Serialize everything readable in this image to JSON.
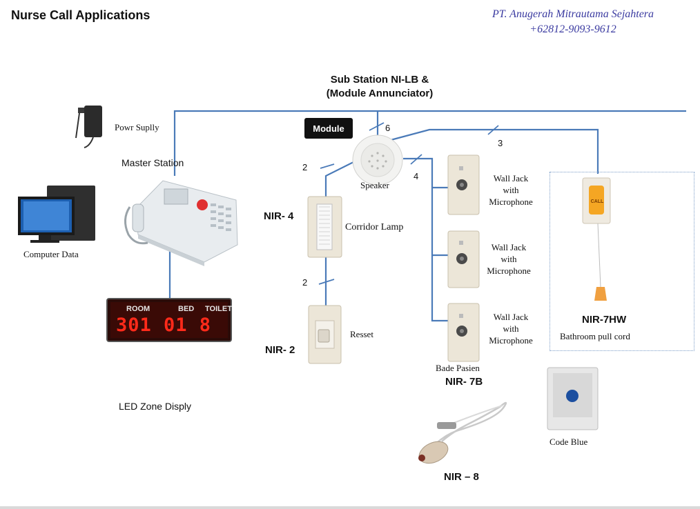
{
  "header": {
    "title": "Nurse Call Applications",
    "company_name": "PT. Anugerah Mitrautama Sejahtera",
    "company_phone": "+62812-9093-9612"
  },
  "substation": {
    "line1": "Sub Station  NI-LB &",
    "line2": "(Module Annunciator)"
  },
  "module_label": "Module",
  "labels": {
    "power_supply": "Powr Suplly",
    "master_station": "Master Station",
    "computer_data": "Computer Data",
    "led_zone_display": "LED Zone Disply",
    "speaker": "Speaker",
    "corridor_lamp": "Corridor Lamp",
    "reset": "Resset",
    "wall_jack_1": [
      "Wall Jack",
      "with",
      "Microphone"
    ],
    "wall_jack_2": [
      "Wall Jack",
      "with",
      "Microphone"
    ],
    "wall_jack_3": [
      "Wall Jack",
      "with",
      "Microphone"
    ],
    "bed_patient": "Bade Pasien",
    "bathroom_pull_cord": "Bathroom pull cord",
    "code_blue": "Code Blue"
  },
  "codes": {
    "nir4": "NIR- 4",
    "nir2": "NIR- 2",
    "nir7b": "NIR- 7B",
    "nir7hw": "NIR-7HW",
    "nir8": "NIR – 8"
  },
  "wire_counts": {
    "to_module": "6",
    "to_bathroom": "3",
    "to_corridor": "2",
    "to_walljacks": "4",
    "corridor_to_reset": "2"
  },
  "led_display": {
    "room_label": "ROOM",
    "bed_label": "BED",
    "toilet_label": "TOILET",
    "digits": "301 01 8"
  },
  "pull_cord_button": "CALL",
  "colors": {
    "wire": "#4a7ab8",
    "company_text": "#3a3aa0",
    "led_red": "#ff2a1a"
  }
}
